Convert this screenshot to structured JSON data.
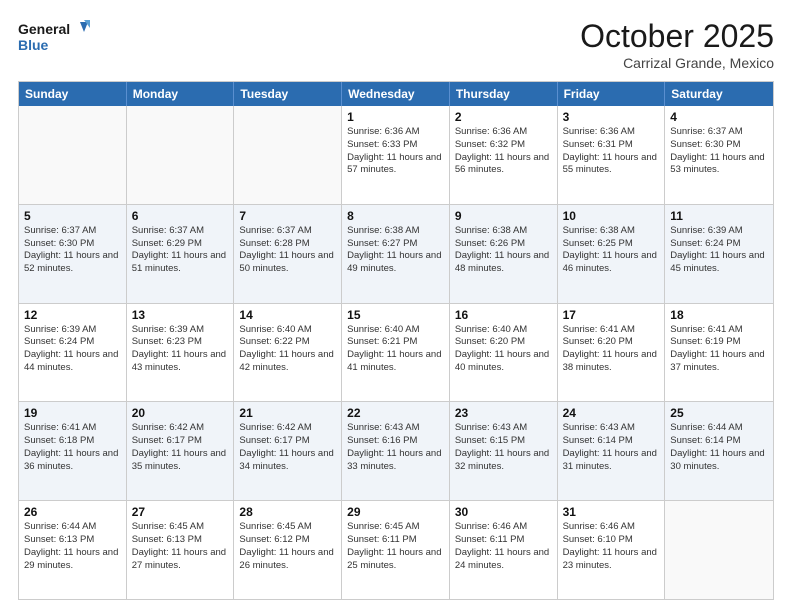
{
  "logo": {
    "line1": "General",
    "line2": "Blue"
  },
  "title": "October 2025",
  "location": "Carrizal Grande, Mexico",
  "weekdays": [
    "Sunday",
    "Monday",
    "Tuesday",
    "Wednesday",
    "Thursday",
    "Friday",
    "Saturday"
  ],
  "rows": [
    [
      {
        "day": "",
        "info": ""
      },
      {
        "day": "",
        "info": ""
      },
      {
        "day": "",
        "info": ""
      },
      {
        "day": "1",
        "info": "Sunrise: 6:36 AM\nSunset: 6:33 PM\nDaylight: 11 hours and 57 minutes."
      },
      {
        "day": "2",
        "info": "Sunrise: 6:36 AM\nSunset: 6:32 PM\nDaylight: 11 hours and 56 minutes."
      },
      {
        "day": "3",
        "info": "Sunrise: 6:36 AM\nSunset: 6:31 PM\nDaylight: 11 hours and 55 minutes."
      },
      {
        "day": "4",
        "info": "Sunrise: 6:37 AM\nSunset: 6:30 PM\nDaylight: 11 hours and 53 minutes."
      }
    ],
    [
      {
        "day": "5",
        "info": "Sunrise: 6:37 AM\nSunset: 6:30 PM\nDaylight: 11 hours and 52 minutes."
      },
      {
        "day": "6",
        "info": "Sunrise: 6:37 AM\nSunset: 6:29 PM\nDaylight: 11 hours and 51 minutes."
      },
      {
        "day": "7",
        "info": "Sunrise: 6:37 AM\nSunset: 6:28 PM\nDaylight: 11 hours and 50 minutes."
      },
      {
        "day": "8",
        "info": "Sunrise: 6:38 AM\nSunset: 6:27 PM\nDaylight: 11 hours and 49 minutes."
      },
      {
        "day": "9",
        "info": "Sunrise: 6:38 AM\nSunset: 6:26 PM\nDaylight: 11 hours and 48 minutes."
      },
      {
        "day": "10",
        "info": "Sunrise: 6:38 AM\nSunset: 6:25 PM\nDaylight: 11 hours and 46 minutes."
      },
      {
        "day": "11",
        "info": "Sunrise: 6:39 AM\nSunset: 6:24 PM\nDaylight: 11 hours and 45 minutes."
      }
    ],
    [
      {
        "day": "12",
        "info": "Sunrise: 6:39 AM\nSunset: 6:24 PM\nDaylight: 11 hours and 44 minutes."
      },
      {
        "day": "13",
        "info": "Sunrise: 6:39 AM\nSunset: 6:23 PM\nDaylight: 11 hours and 43 minutes."
      },
      {
        "day": "14",
        "info": "Sunrise: 6:40 AM\nSunset: 6:22 PM\nDaylight: 11 hours and 42 minutes."
      },
      {
        "day": "15",
        "info": "Sunrise: 6:40 AM\nSunset: 6:21 PM\nDaylight: 11 hours and 41 minutes."
      },
      {
        "day": "16",
        "info": "Sunrise: 6:40 AM\nSunset: 6:20 PM\nDaylight: 11 hours and 40 minutes."
      },
      {
        "day": "17",
        "info": "Sunrise: 6:41 AM\nSunset: 6:20 PM\nDaylight: 11 hours and 38 minutes."
      },
      {
        "day": "18",
        "info": "Sunrise: 6:41 AM\nSunset: 6:19 PM\nDaylight: 11 hours and 37 minutes."
      }
    ],
    [
      {
        "day": "19",
        "info": "Sunrise: 6:41 AM\nSunset: 6:18 PM\nDaylight: 11 hours and 36 minutes."
      },
      {
        "day": "20",
        "info": "Sunrise: 6:42 AM\nSunset: 6:17 PM\nDaylight: 11 hours and 35 minutes."
      },
      {
        "day": "21",
        "info": "Sunrise: 6:42 AM\nSunset: 6:17 PM\nDaylight: 11 hours and 34 minutes."
      },
      {
        "day": "22",
        "info": "Sunrise: 6:43 AM\nSunset: 6:16 PM\nDaylight: 11 hours and 33 minutes."
      },
      {
        "day": "23",
        "info": "Sunrise: 6:43 AM\nSunset: 6:15 PM\nDaylight: 11 hours and 32 minutes."
      },
      {
        "day": "24",
        "info": "Sunrise: 6:43 AM\nSunset: 6:14 PM\nDaylight: 11 hours and 31 minutes."
      },
      {
        "day": "25",
        "info": "Sunrise: 6:44 AM\nSunset: 6:14 PM\nDaylight: 11 hours and 30 minutes."
      }
    ],
    [
      {
        "day": "26",
        "info": "Sunrise: 6:44 AM\nSunset: 6:13 PM\nDaylight: 11 hours and 29 minutes."
      },
      {
        "day": "27",
        "info": "Sunrise: 6:45 AM\nSunset: 6:13 PM\nDaylight: 11 hours and 27 minutes."
      },
      {
        "day": "28",
        "info": "Sunrise: 6:45 AM\nSunset: 6:12 PM\nDaylight: 11 hours and 26 minutes."
      },
      {
        "day": "29",
        "info": "Sunrise: 6:45 AM\nSunset: 6:11 PM\nDaylight: 11 hours and 25 minutes."
      },
      {
        "day": "30",
        "info": "Sunrise: 6:46 AM\nSunset: 6:11 PM\nDaylight: 11 hours and 24 minutes."
      },
      {
        "day": "31",
        "info": "Sunrise: 6:46 AM\nSunset: 6:10 PM\nDaylight: 11 hours and 23 minutes."
      },
      {
        "day": "",
        "info": ""
      }
    ]
  ]
}
